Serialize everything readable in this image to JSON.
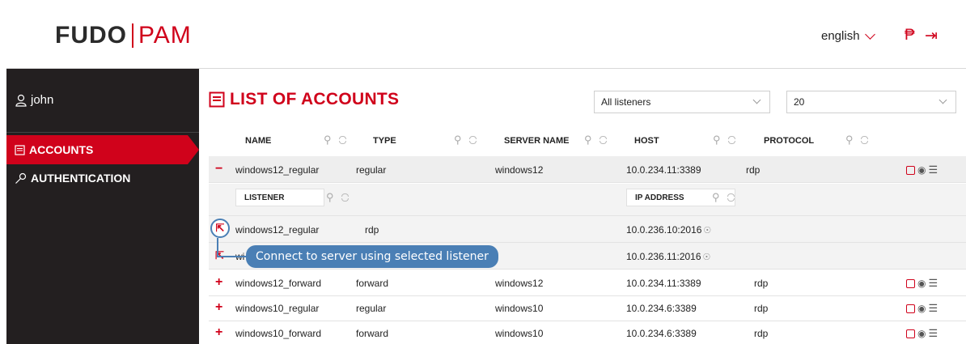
{
  "header": {
    "logo_fudo": "FUDO",
    "logo_pam": "PAM",
    "language": "english"
  },
  "sidebar": {
    "user": "john",
    "items": [
      {
        "label": "ACCOUNTS",
        "active": true
      },
      {
        "label": "AUTHENTICATION",
        "active": false
      }
    ]
  },
  "main": {
    "title": "LIST OF ACCOUNTS",
    "listener_filter": "All listeners",
    "page_size": "20",
    "columns": [
      "NAME",
      "TYPE",
      "SERVER NAME",
      "HOST",
      "PROTOCOL"
    ],
    "sub_columns": [
      "LISTENER",
      "IP ADDRESS"
    ],
    "rows": [
      {
        "toggle": "−",
        "name": "windows12_regular",
        "type": "regular",
        "server": "windows12",
        "host": "10.0.234.11:3389",
        "protocol": "rdp"
      },
      {
        "toggle": "+",
        "name": "windows12_forward",
        "type": "forward",
        "server": "windows12",
        "host": "10.0.234.11:3389",
        "protocol": "rdp"
      },
      {
        "toggle": "+",
        "name": "windows10_regular",
        "type": "regular",
        "server": "windows10",
        "host": "10.0.234.6:3389",
        "protocol": "rdp"
      },
      {
        "toggle": "+",
        "name": "windows10_forward",
        "type": "forward",
        "server": "windows10",
        "host": "10.0.234.6:3389",
        "protocol": "rdp"
      }
    ],
    "listeners": [
      {
        "name": "windows12_regular",
        "protocol": "rdp",
        "ip": "10.0.236.10:2016"
      },
      {
        "name": "wi",
        "protocol": "",
        "ip": "10.0.236.11:2016"
      }
    ]
  },
  "tooltip": "Connect to server using selected listener",
  "colors": {
    "accent": "#d0021b",
    "sidebar": "#231f20",
    "tooltip": "#4a7fb5"
  }
}
